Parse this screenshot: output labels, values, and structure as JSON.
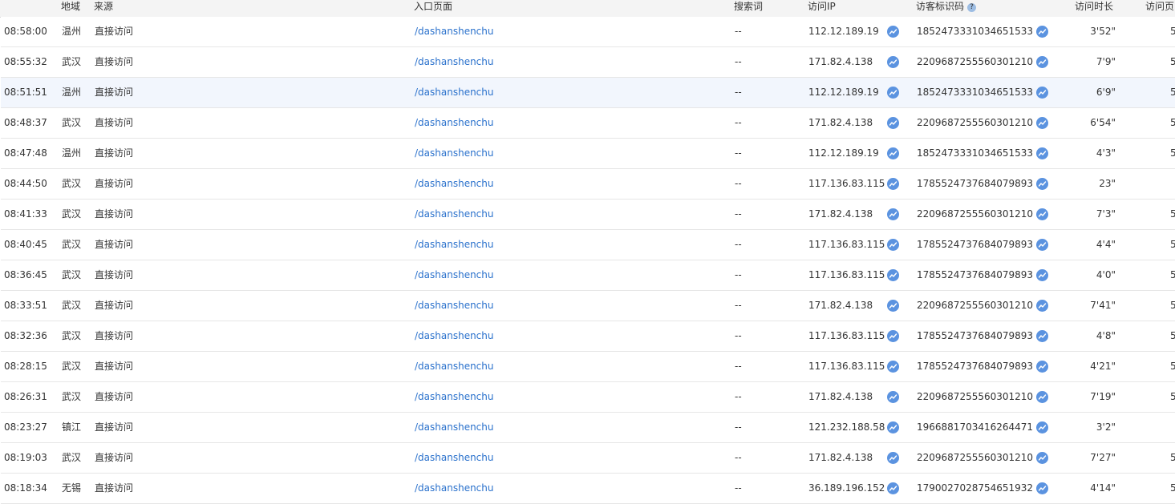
{
  "headers": {
    "region": "地域",
    "source": "来源",
    "entry": "入口页面",
    "keyword": "搜索词",
    "ip": "访问IP",
    "visitor_id": "访客标识码",
    "info_icon": "?",
    "duration": "访问时长",
    "pages": "访问页"
  },
  "icons": {
    "trend": "trend-line-icon",
    "info": "question-circle-icon"
  },
  "colors": {
    "link": "#2a71cc",
    "trend_icon": "#5b93e0",
    "highlight_row": "#f2f6fd"
  },
  "rows": [
    {
      "time": "08:58:00",
      "region": "温州",
      "source": "直接访问",
      "entry": "/dashanshenchu",
      "keyword": "--",
      "ip": "112.12.189.19",
      "visitor_id": "1852473331034651533",
      "duration": "3'52\"",
      "pages": "5"
    },
    {
      "time": "08:55:32",
      "region": "武汉",
      "source": "直接访问",
      "entry": "/dashanshenchu",
      "keyword": "--",
      "ip": "171.82.4.138",
      "visitor_id": "2209687255560301210",
      "duration": "7'9\"",
      "pages": "5"
    },
    {
      "time": "08:51:51",
      "region": "温州",
      "source": "直接访问",
      "entry": "/dashanshenchu",
      "keyword": "--",
      "ip": "112.12.189.19",
      "visitor_id": "1852473331034651533",
      "duration": "6'9\"",
      "pages": "5",
      "highlight": true
    },
    {
      "time": "08:48:37",
      "region": "武汉",
      "source": "直接访问",
      "entry": "/dashanshenchu",
      "keyword": "--",
      "ip": "171.82.4.138",
      "visitor_id": "2209687255560301210",
      "duration": "6'54\"",
      "pages": "5"
    },
    {
      "time": "08:47:48",
      "region": "温州",
      "source": "直接访问",
      "entry": "/dashanshenchu",
      "keyword": "--",
      "ip": "112.12.189.19",
      "visitor_id": "1852473331034651533",
      "duration": "4'3\"",
      "pages": "5"
    },
    {
      "time": "08:44:50",
      "region": "武汉",
      "source": "直接访问",
      "entry": "/dashanshenchu",
      "keyword": "--",
      "ip": "117.136.83.115",
      "visitor_id": "1785524737684079893",
      "duration": "23\"",
      "pages": ""
    },
    {
      "time": "08:41:33",
      "region": "武汉",
      "source": "直接访问",
      "entry": "/dashanshenchu",
      "keyword": "--",
      "ip": "171.82.4.138",
      "visitor_id": "2209687255560301210",
      "duration": "7'3\"",
      "pages": "5"
    },
    {
      "time": "08:40:45",
      "region": "武汉",
      "source": "直接访问",
      "entry": "/dashanshenchu",
      "keyword": "--",
      "ip": "117.136.83.115",
      "visitor_id": "1785524737684079893",
      "duration": "4'4\"",
      "pages": "5"
    },
    {
      "time": "08:36:45",
      "region": "武汉",
      "source": "直接访问",
      "entry": "/dashanshenchu",
      "keyword": "--",
      "ip": "117.136.83.115",
      "visitor_id": "1785524737684079893",
      "duration": "4'0\"",
      "pages": "5"
    },
    {
      "time": "08:33:51",
      "region": "武汉",
      "source": "直接访问",
      "entry": "/dashanshenchu",
      "keyword": "--",
      "ip": "171.82.4.138",
      "visitor_id": "2209687255560301210",
      "duration": "7'41\"",
      "pages": "5"
    },
    {
      "time": "08:32:36",
      "region": "武汉",
      "source": "直接访问",
      "entry": "/dashanshenchu",
      "keyword": "--",
      "ip": "117.136.83.115",
      "visitor_id": "1785524737684079893",
      "duration": "4'8\"",
      "pages": "5"
    },
    {
      "time": "08:28:15",
      "region": "武汉",
      "source": "直接访问",
      "entry": "/dashanshenchu",
      "keyword": "--",
      "ip": "117.136.83.115",
      "visitor_id": "1785524737684079893",
      "duration": "4'21\"",
      "pages": "5"
    },
    {
      "time": "08:26:31",
      "region": "武汉",
      "source": "直接访问",
      "entry": "/dashanshenchu",
      "keyword": "--",
      "ip": "171.82.4.138",
      "visitor_id": "2209687255560301210",
      "duration": "7'19\"",
      "pages": "5"
    },
    {
      "time": "08:23:27",
      "region": "镇江",
      "source": "直接访问",
      "entry": "/dashanshenchu",
      "keyword": "--",
      "ip": "121.232.188.58",
      "visitor_id": "1966881703416264471",
      "duration": "3'2\"",
      "pages": ""
    },
    {
      "time": "08:19:03",
      "region": "武汉",
      "source": "直接访问",
      "entry": "/dashanshenchu",
      "keyword": "--",
      "ip": "171.82.4.138",
      "visitor_id": "2209687255560301210",
      "duration": "7'27\"",
      "pages": "5"
    },
    {
      "time": "08:18:34",
      "region": "无锡",
      "source": "直接访问",
      "entry": "/dashanshenchu",
      "keyword": "--",
      "ip": "36.189.196.152",
      "visitor_id": "1790027028754651932",
      "duration": "4'14\"",
      "pages": "5"
    }
  ]
}
